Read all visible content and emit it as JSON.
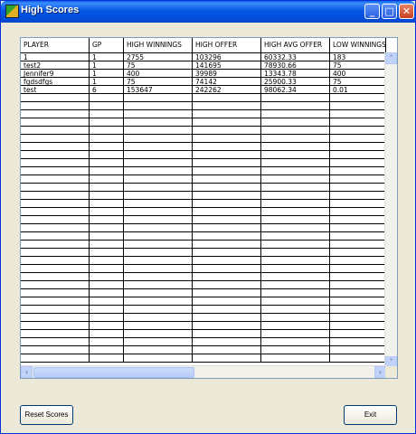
{
  "window": {
    "title": "High Scores"
  },
  "titlebar_buttons": {
    "minimize": "_",
    "maximize": "□",
    "close": "✕"
  },
  "table": {
    "columns": [
      "PLAYER",
      "GP",
      "HIGH WINNINGS",
      "HIGH OFFER",
      "HIGH AVG OFFER",
      "LOW WINNINGS"
    ],
    "rows": [
      [
        "1",
        "1",
        "2755",
        "103296",
        "60332.33",
        "183"
      ],
      [
        "test2",
        "1",
        "75",
        "141695",
        "78930.66",
        "75"
      ],
      [
        "Jennifer9",
        "1",
        "400",
        "39989",
        "13343.78",
        "400"
      ],
      [
        "fgdsdfgs",
        "1",
        "75",
        "74142",
        "25900.33",
        "75"
      ],
      [
        "test",
        "6",
        "153647",
        "242262",
        "98062.34",
        "0.01"
      ]
    ]
  },
  "scroll": {
    "left": "‹",
    "right": "›",
    "up": "˄",
    "down": "˅"
  },
  "buttons": {
    "reset": "Reset Scores",
    "exit": "Exit"
  }
}
